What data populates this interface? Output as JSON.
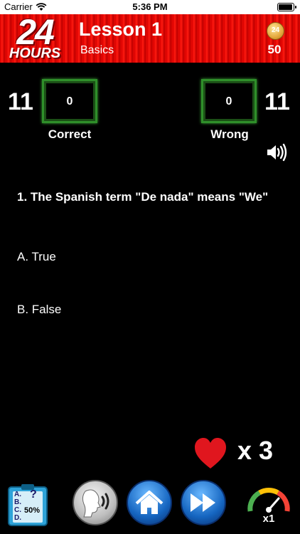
{
  "status_bar": {
    "carrier": "Carrier",
    "time": "5:36 PM"
  },
  "header": {
    "logo_number": "24",
    "logo_word": "HOURS",
    "title": "Lesson 1",
    "subtitle": "Basics",
    "coin_label": "24",
    "coins": "50"
  },
  "score": {
    "left_total": "11",
    "correct_count": "0",
    "correct_label": "Correct",
    "wrong_count": "0",
    "wrong_label": "Wrong",
    "right_total": "11"
  },
  "question": {
    "text": "1. The Spanish term \"De nada\" means \"We\"",
    "options": [
      "A. True",
      "B. False"
    ]
  },
  "lives": {
    "label": "x 3"
  },
  "toolbar": {
    "hint_letters": [
      "A.",
      "B.",
      "C.",
      "D."
    ],
    "hint_percent": "50%",
    "hint_mark": "?",
    "speed_label": "x1"
  },
  "colors": {
    "header_red": "#e00a04",
    "score_box_green": "#2f8f2a",
    "heart_red": "#e0161e",
    "button_blue": "#1565c0"
  },
  "icons": [
    "wifi-icon",
    "battery-icon",
    "coin-icon",
    "speaker-icon",
    "heart-icon",
    "hint-clipboard-icon",
    "voice-icon",
    "home-icon",
    "fast-forward-icon",
    "speedometer-icon"
  ]
}
